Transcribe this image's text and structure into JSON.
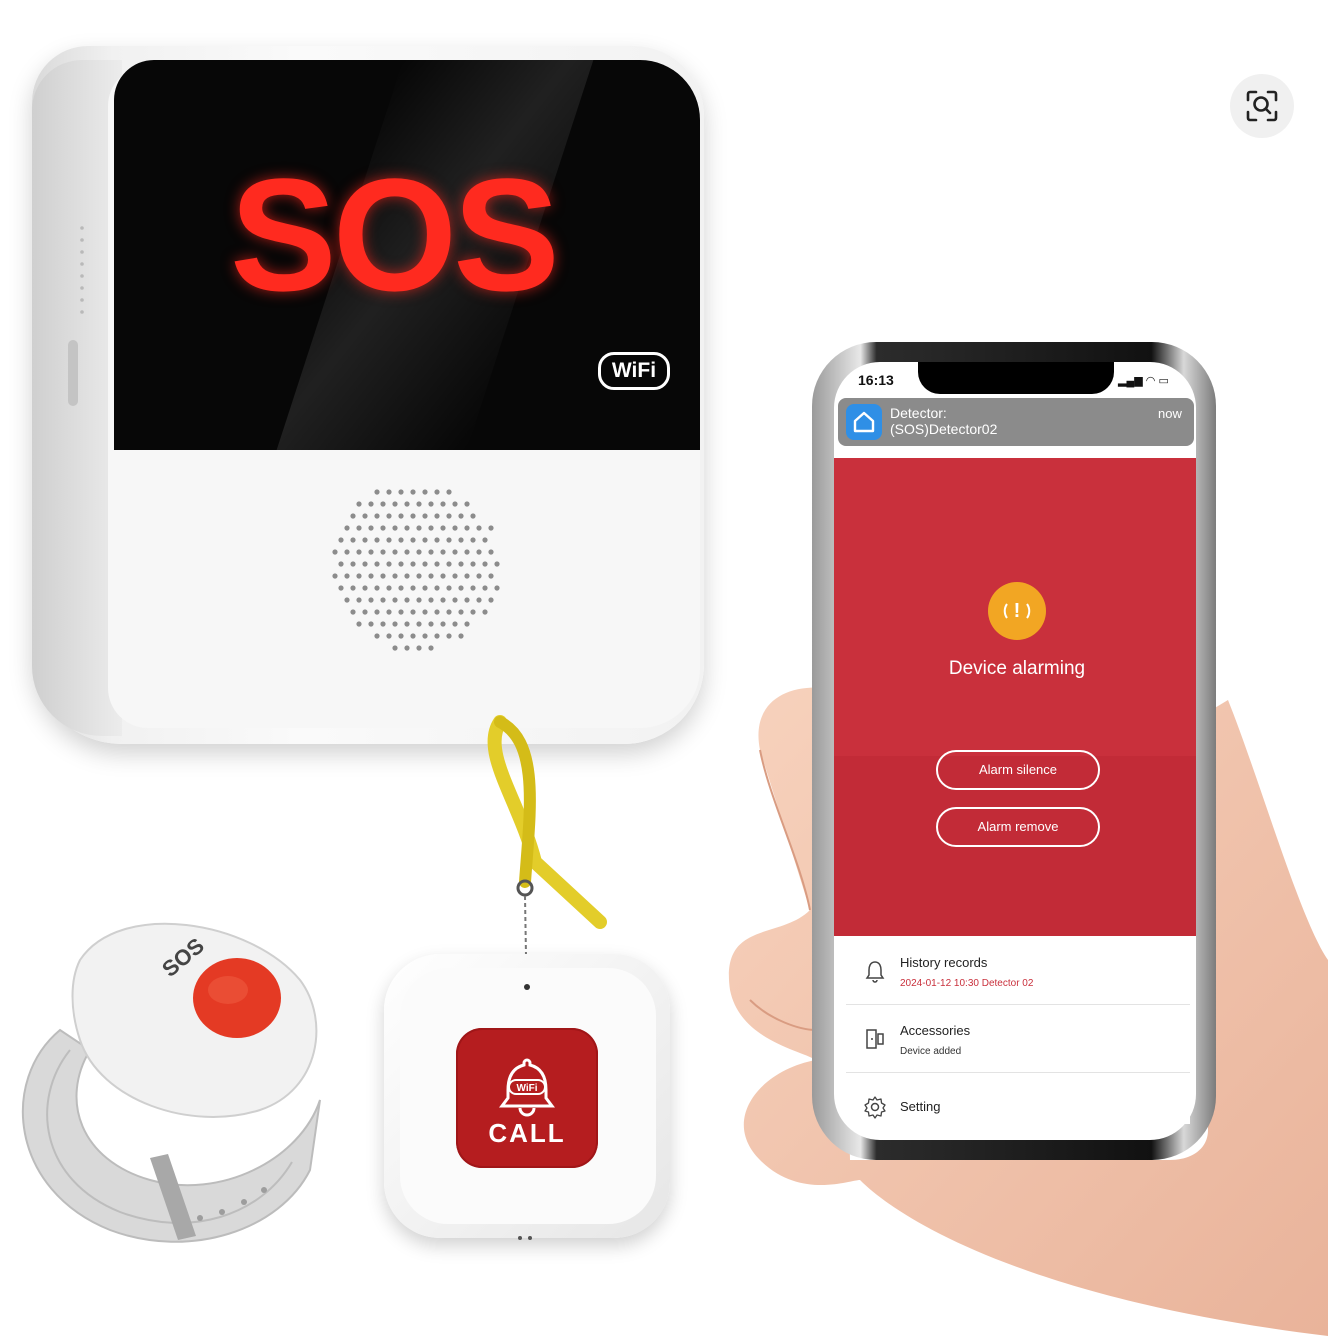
{
  "hub": {
    "display_text": "SOS",
    "wifi_badge": "WiFi"
  },
  "pendant": {
    "button_label": "CALL",
    "wifi_badge": "WiFi"
  },
  "wristband": {
    "label": "SOS"
  },
  "phone": {
    "status_time": "16:13",
    "notification": {
      "title": "Detector:",
      "subtitle": "(SOS)Detector02",
      "time": "now"
    },
    "alarm": {
      "status": "Device alarming",
      "buttons": [
        "Alarm silence",
        "Alarm remove"
      ]
    },
    "menu": [
      {
        "title": "History records",
        "subtitle": "2024-01-12 10:30 Detector 02",
        "icon": "bell-icon"
      },
      {
        "title": "Accessories",
        "subtitle": "Device added",
        "icon": "device-icon"
      },
      {
        "title": "Setting",
        "subtitle": "",
        "icon": "gear-icon"
      }
    ]
  },
  "colors": {
    "alarm_red": "#c9303c",
    "sos_red": "#ff2a1f",
    "badge_orange": "#f2a623",
    "call_red": "#b51d1f",
    "notif_blue": "#2f8fe6"
  },
  "icons": {
    "lens": "visual-search-icon"
  }
}
